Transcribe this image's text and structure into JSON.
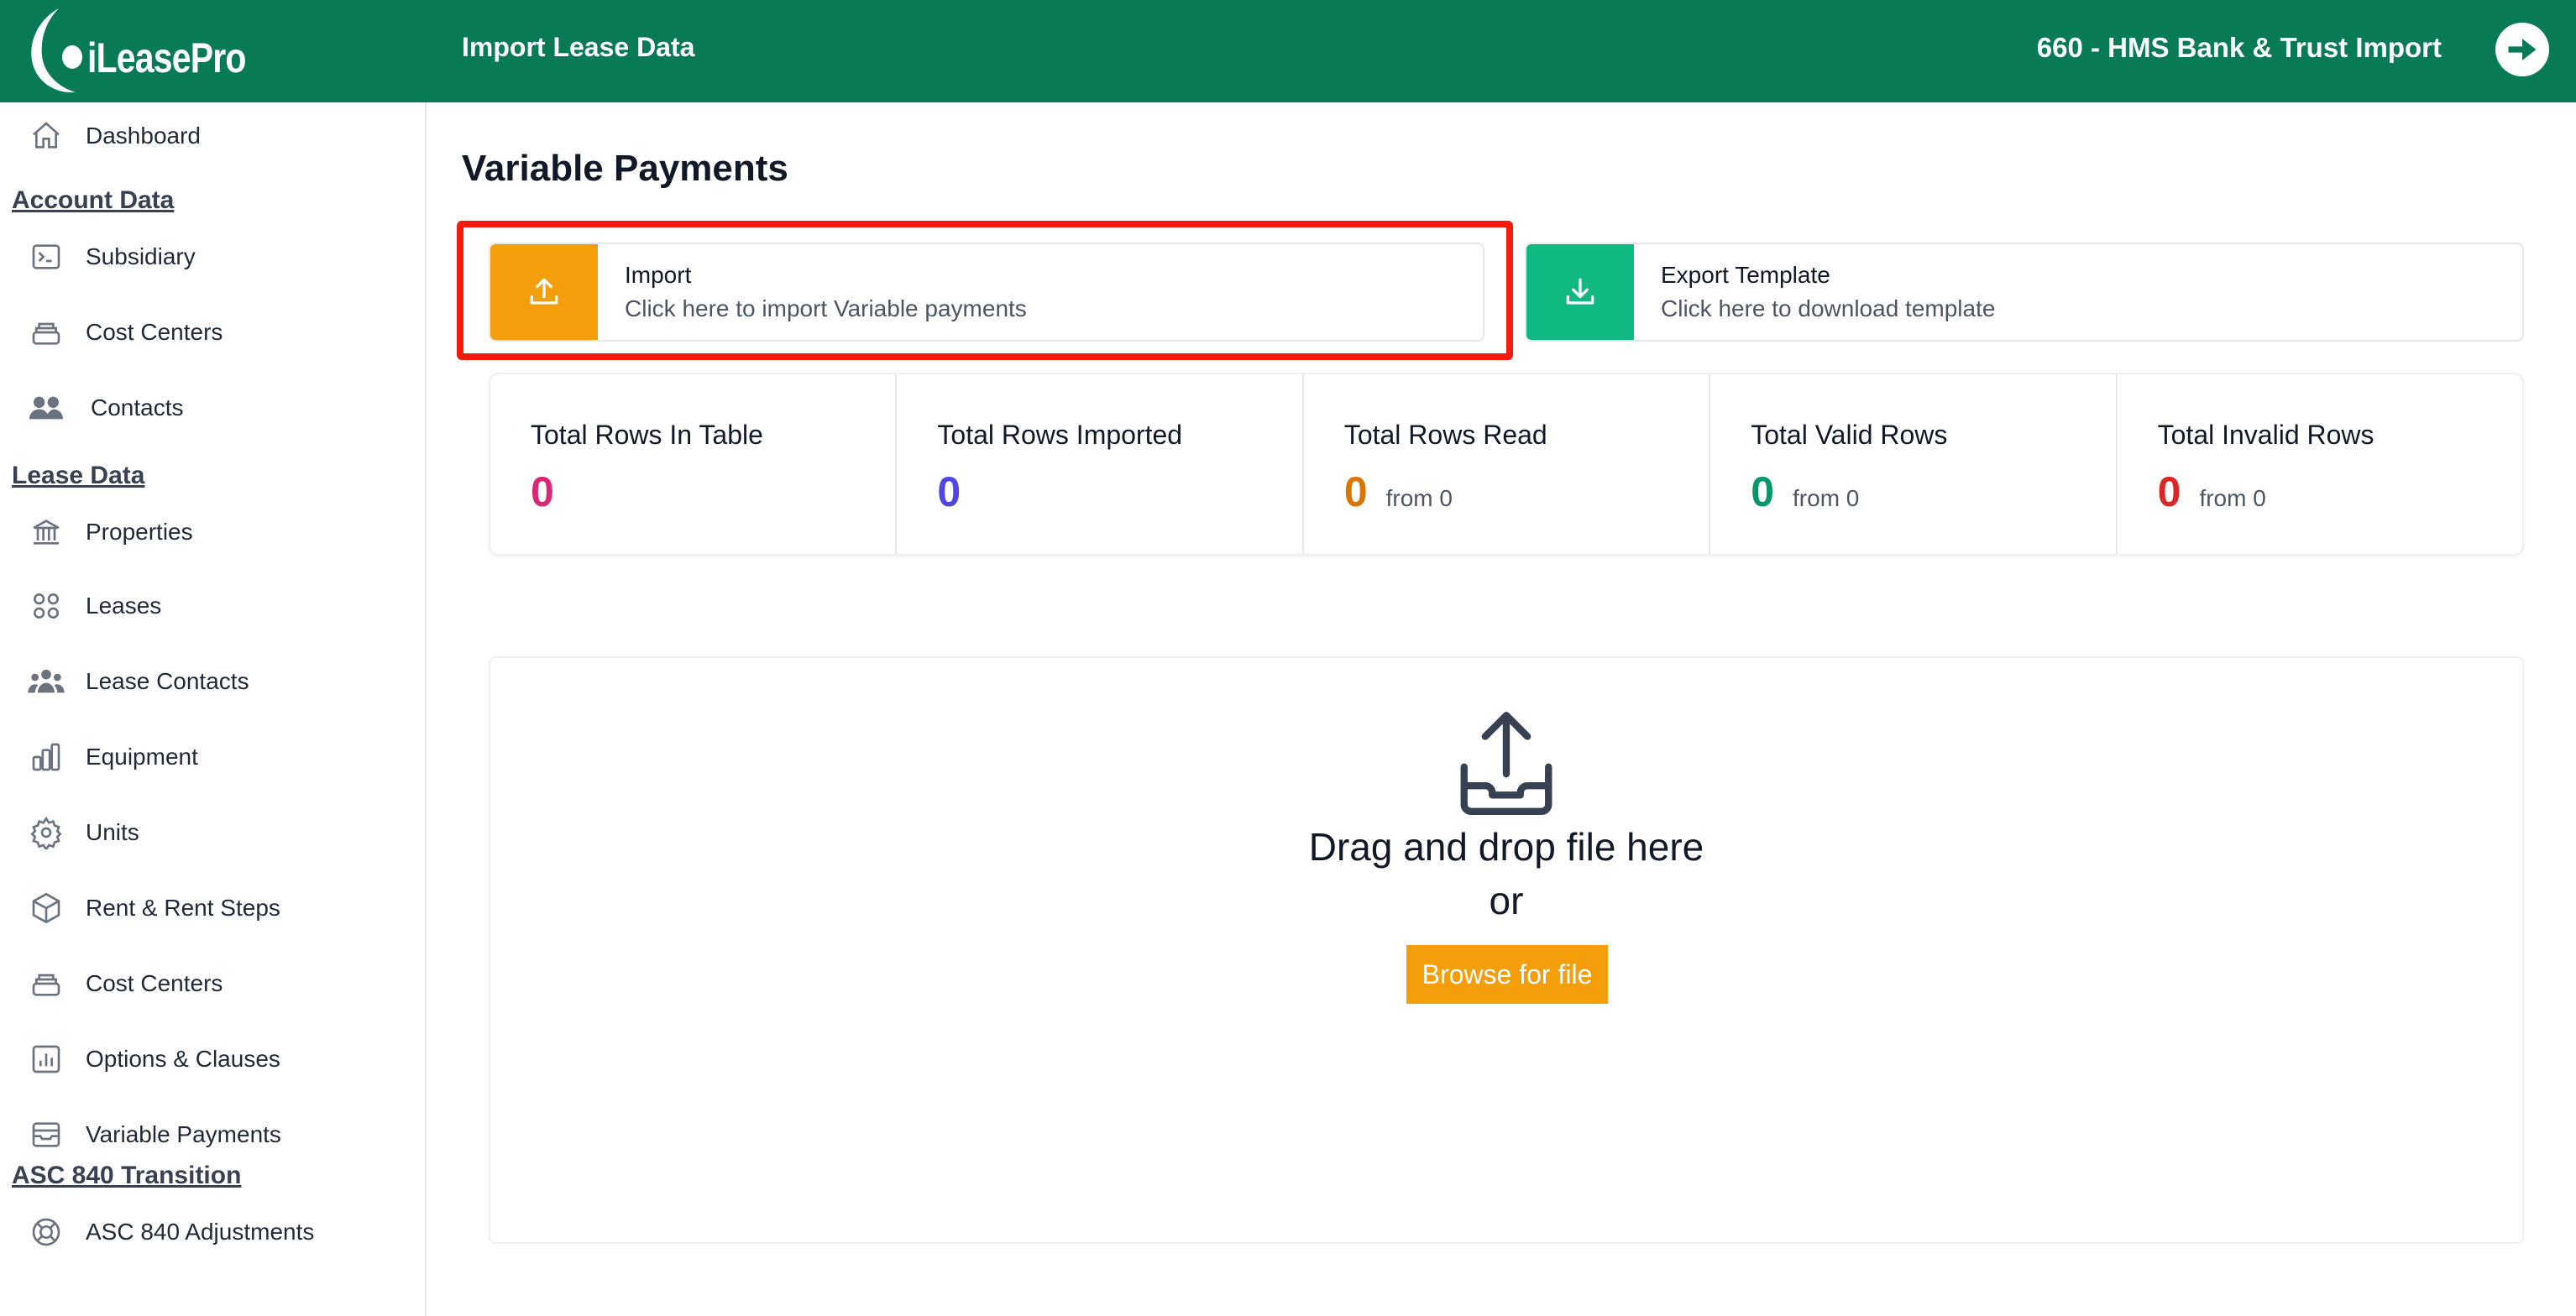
{
  "header": {
    "logo_text": "iLeasePro",
    "title": "Import Lease Data",
    "company": "660 - HMS Bank & Trust Import",
    "logout_icon": "arrow-right-circle-icon"
  },
  "sidebar": {
    "dashboard": {
      "label": "Dashboard",
      "icon": "home-icon"
    },
    "sections": [
      {
        "heading": "Account Data",
        "items": [
          {
            "label": "Subsidiary",
            "icon": "terminal-icon"
          },
          {
            "label": "Cost Centers",
            "icon": "stack-icon"
          },
          {
            "label": "Contacts",
            "icon": "users-icon"
          }
        ]
      },
      {
        "heading": "Lease Data",
        "items": [
          {
            "label": "Properties",
            "icon": "building-icon"
          },
          {
            "label": "Leases",
            "icon": "grid-icon"
          },
          {
            "label": "Lease Contacts",
            "icon": "user-group-icon"
          },
          {
            "label": "Equipment",
            "icon": "bar-chart-icon"
          },
          {
            "label": "Units",
            "icon": "gear-icon"
          },
          {
            "label": "Rent & Rent Steps",
            "icon": "cube-icon"
          },
          {
            "label": "Cost Centers",
            "icon": "stack-icon"
          },
          {
            "label": "Options & Clauses",
            "icon": "chart-box-icon"
          },
          {
            "label": "Variable Payments",
            "icon": "inbox-icon"
          }
        ]
      },
      {
        "heading": "ASC 840 Transition",
        "items": [
          {
            "label": "ASC 840 Adjustments",
            "icon": "lifebuoy-icon"
          }
        ]
      }
    ]
  },
  "main": {
    "title": "Variable Payments",
    "import_card": {
      "title": "Import",
      "subtitle": "Click here to import Variable payments",
      "color": "#f59e0b",
      "icon": "upload-icon"
    },
    "export_card": {
      "title": "Export Template",
      "subtitle": "Click here to download template",
      "color": "#10b981",
      "icon": "download-icon"
    },
    "stats": [
      {
        "label": "Total Rows In Table",
        "value": "0",
        "from": "",
        "color": "#db2777"
      },
      {
        "label": "Total Rows Imported",
        "value": "0",
        "from": "",
        "color": "#4f46e5"
      },
      {
        "label": "Total Rows Read",
        "value": "0",
        "from": "from 0",
        "color": "#d97706"
      },
      {
        "label": "Total Valid Rows",
        "value": "0",
        "from": "from 0",
        "color": "#059669"
      },
      {
        "label": "Total Invalid Rows",
        "value": "0",
        "from": "from 0",
        "color": "#dc2626"
      }
    ],
    "dropzone": {
      "line1": "Drag and drop file here",
      "line2": "or",
      "browse_label": "Browse for file",
      "icon": "upload-tray-icon"
    }
  }
}
